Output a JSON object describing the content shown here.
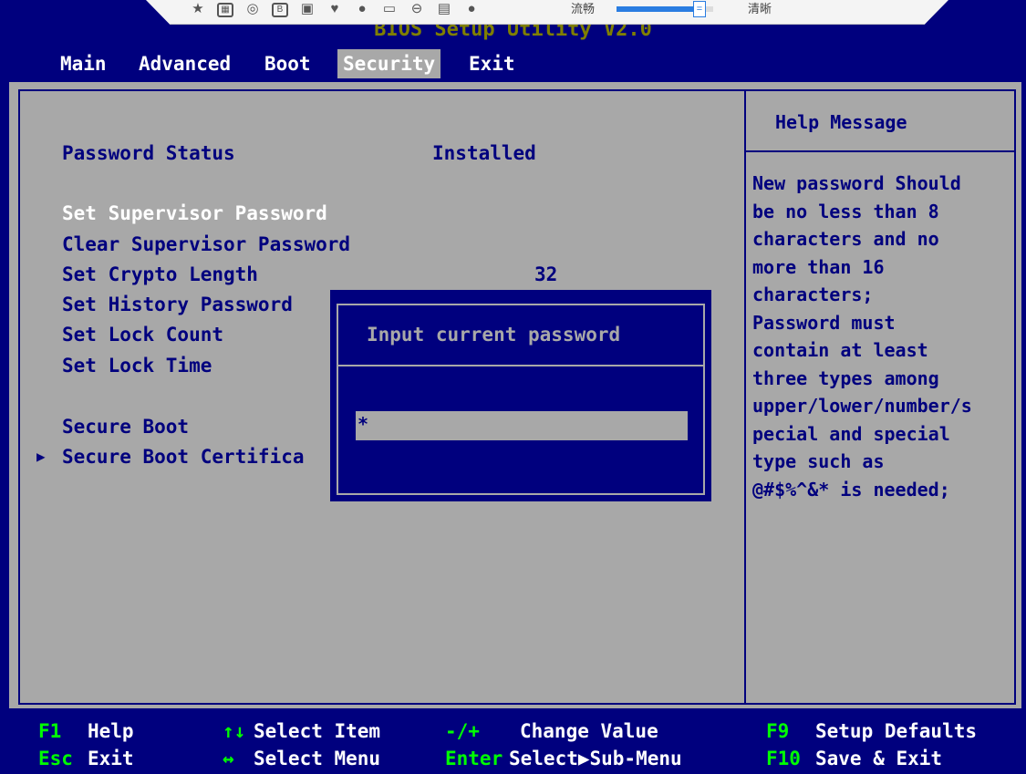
{
  "toolbar": {
    "icons": [
      "pin-icon",
      "screenshot-icon",
      "record-icon",
      "bold-b-icon",
      "image-icon",
      "heart-icon",
      "shield-icon",
      "folder-icon",
      "keyboard-icon",
      "window-icon",
      "help-icon"
    ],
    "fluency_label": "流畅",
    "clarity_label": "清晰",
    "quality_level": 0.8,
    "slider_thumb": "="
  },
  "title": "BIOS Setup Utility V2.0",
  "menu": {
    "tabs": [
      {
        "label": "Main"
      },
      {
        "label": "Advanced"
      },
      {
        "label": "Boot"
      },
      {
        "label": "Security"
      },
      {
        "label": "Exit"
      }
    ],
    "active": "Security"
  },
  "settings": {
    "password_status_label": "Password Status",
    "password_status_value": "Installed",
    "set_supervisor": "Set Supervisor Password",
    "clear_supervisor": "Clear Supervisor Password",
    "crypto_length_label": "Set Crypto Length",
    "crypto_length_value": "32",
    "history_password": "Set History Password",
    "lock_count": "Set Lock Count",
    "lock_time": "Set Lock Time",
    "secure_boot": "Secure Boot",
    "secure_boot_cert": "Secure Boot Certifica",
    "submenu_arrow": "▶"
  },
  "help": {
    "title": "Help Message",
    "text": "New password Should\nbe no less than 8\ncharacters and no\nmore than 16\ncharacters;\nPassword must\ncontain at least\nthree types among\nupper/lower/number/s\npecial and special\ntype such as\n@#$%^&* is needed;"
  },
  "dialog": {
    "title": "Input current password",
    "input_value": "*"
  },
  "footer": {
    "f1_key": "F1",
    "f1_desc": "Help",
    "esc_key": "Esc",
    "esc_desc": "Exit",
    "updown_key": "↑↓",
    "updown_desc": "Select Item",
    "leftright_key": "↔",
    "leftright_desc": "Select Menu",
    "plusminus_key": "-/+",
    "plusminus_desc": "Change Value",
    "enter_key": "Enter",
    "enter_desc": "Select▶Sub-Menu",
    "f9_key": "F9",
    "f9_desc": "Setup Defaults",
    "f10_key": "F10",
    "f10_desc": "Save & Exit"
  },
  "colors": {
    "bios_blue": "#00007e",
    "bios_gray": "#a8a8a8",
    "footer_key_green": "#00ff00",
    "title_olive": "#7f7f00"
  }
}
